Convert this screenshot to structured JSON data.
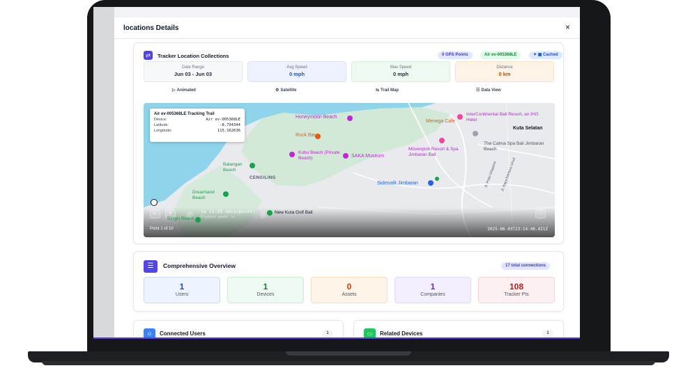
{
  "modal": {
    "title": "locations Details",
    "close_label": "×"
  },
  "tracker": {
    "title": "Tracker Location Collections",
    "badges": {
      "gps": "0 GPS Points",
      "air": "Air ev-005368LE",
      "cached": "Cached"
    },
    "stats": [
      {
        "label": "Date Range",
        "value": "Jun 03 - Jun 03"
      },
      {
        "label": "Avg Speed",
        "value": "0 mph"
      },
      {
        "label": "Max Speed",
        "value": "0 mph"
      },
      {
        "label": "Distance",
        "value": "0 km"
      }
    ],
    "view_buttons": [
      {
        "label": "Animated",
        "icon": "play-icon"
      },
      {
        "label": "Satellite",
        "icon": "satellite-icon"
      },
      {
        "label": "Trail Map",
        "icon": "map-icon"
      },
      {
        "label": "Data View",
        "icon": "table-icon"
      }
    ]
  },
  "map": {
    "popup": {
      "title": "Air ev-005368LE Tracking Trail",
      "rows": [
        {
          "label": "Device:",
          "value": "Air ev-005368LE"
        },
        {
          "label": "Latitude:",
          "value": "-8.794344"
        },
        {
          "label": "Longitude:",
          "value": "115.162636"
        }
      ]
    },
    "places": {
      "honeymoon": "Honeymoon Beach",
      "menega": "Menega Cafe",
      "intercontinental": "InterContinental Bali Resort, an IHG Hotel",
      "kuta": "Kuta Selatan",
      "rockbar": "Rock Bar",
      "calma": "The Calma Spa Bali Jimbaran Beach",
      "kubu": "Kubu Beach (Private Beach)",
      "saka": "SAKA Museum",
      "movenpick": "Mövenpick Resort & Spa Jimbaran Bali",
      "balangan": "Balangan Beach",
      "cengiling": "CENGILING",
      "sidewalk": "Sidewalk Jimbaran",
      "dreamland": "Dreamland Beach",
      "golf": "New Kuta Golf Bali",
      "bingin": "Bingin Beach",
      "road1": "Jl. Pratu Udayana",
      "road2": "Jl. Raya Kampus Unud"
    },
    "playback": {
      "speed": "1x (1.25 secs/point)",
      "speed_note": "Playback speed: 1x",
      "point": "Point 1 of 10",
      "timestamp": "2025-06-03T23:14:46.421Z"
    }
  },
  "overview": {
    "title": "Comprehensive Overview",
    "connections": "17 total connections",
    "stats": [
      {
        "value": "1",
        "label": "Users",
        "bg": "#eef4ff",
        "border": "#c9dafb",
        "color": "#1d4ed8"
      },
      {
        "value": "1",
        "label": "Devices",
        "bg": "#eefaf1",
        "border": "#c9ecd4",
        "color": "#15803d"
      },
      {
        "value": "0",
        "label": "Assets",
        "bg": "#fdf3e7",
        "border": "#f6e0c2",
        "color": "#c2410c"
      },
      {
        "value": "1",
        "label": "Companies",
        "bg": "#f4efff",
        "border": "#e2d6fb",
        "color": "#6d28d9"
      },
      {
        "value": "108",
        "label": "Tracker Pts",
        "bg": "#fdf0f0",
        "border": "#f6d3d3",
        "color": "#b91c1c"
      }
    ]
  },
  "connected_users": {
    "title": "Connected Users",
    "count": "1"
  },
  "related_devices": {
    "title": "Related Devices",
    "count": "1"
  },
  "colors": {
    "accent": "#4f46e5",
    "green": "#16a34a",
    "water": "#8fd4ea",
    "land": "#e8eaed",
    "park": "#cde9d2"
  }
}
